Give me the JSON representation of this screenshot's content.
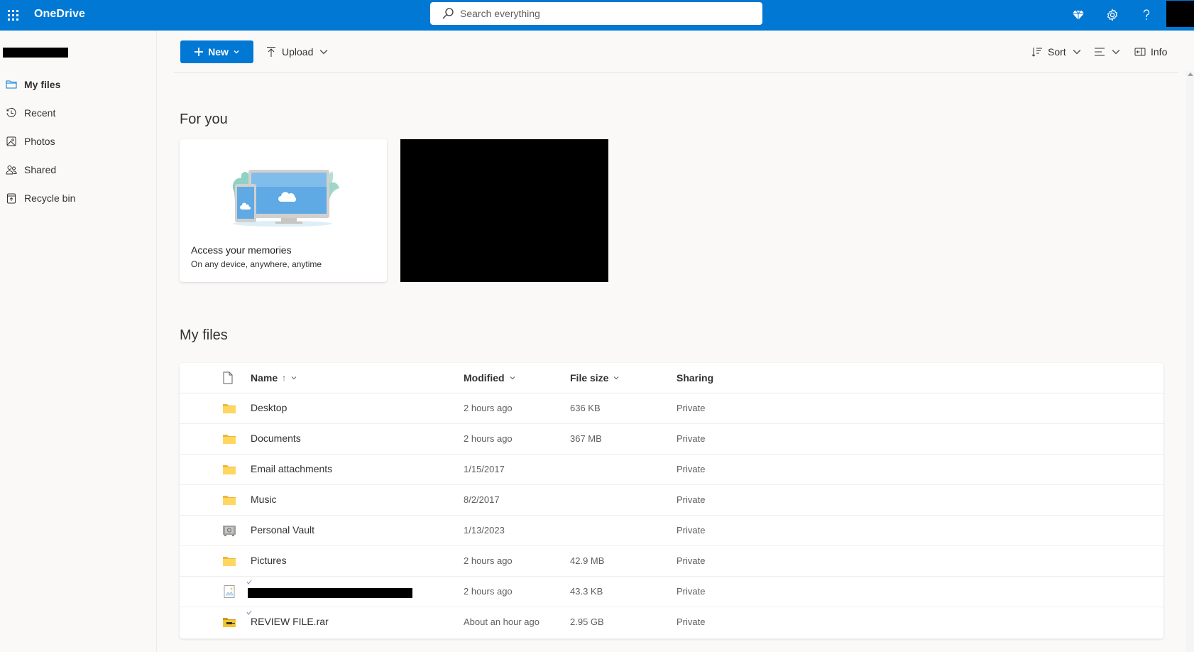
{
  "app": {
    "title": "OneDrive",
    "search_placeholder": "Search everything"
  },
  "topbar": {
    "icons": [
      "app-launcher-icon",
      "premium-diamond-icon",
      "settings-gear-icon",
      "help-icon"
    ]
  },
  "sidebar": {
    "items": [
      {
        "label": "My files",
        "icon": "folder-icon",
        "active": true
      },
      {
        "label": "Recent",
        "icon": "clock-icon",
        "active": false
      },
      {
        "label": "Photos",
        "icon": "photo-icon",
        "active": false
      },
      {
        "label": "Shared",
        "icon": "people-icon",
        "active": false
      },
      {
        "label": "Recycle bin",
        "icon": "recycle-bin-icon",
        "active": false
      }
    ]
  },
  "commandbar": {
    "new_label": "New",
    "upload_label": "Upload",
    "sort_label": "Sort",
    "info_label": "Info"
  },
  "for_you": {
    "title": "For you",
    "card": {
      "title": "Access your memories",
      "subtitle": "On any device, anywhere, anytime"
    }
  },
  "my_files": {
    "title": "My files",
    "columns": {
      "name": "Name",
      "name_sort_indicator": "↑",
      "modified": "Modified",
      "file_size": "File size",
      "sharing": "Sharing"
    },
    "rows": [
      {
        "name": "Desktop",
        "type": "folder",
        "modified": "2 hours ago",
        "size": "636 KB",
        "sharing": "Private"
      },
      {
        "name": "Documents",
        "type": "folder",
        "modified": "2 hours ago",
        "size": "367 MB",
        "sharing": "Private"
      },
      {
        "name": "Email attachments",
        "type": "folder",
        "modified": "1/15/2017",
        "size": "",
        "sharing": "Private"
      },
      {
        "name": "Music",
        "type": "folder",
        "modified": "8/2/2017",
        "size": "",
        "sharing": "Private"
      },
      {
        "name": "Personal Vault",
        "type": "vault",
        "modified": "1/13/2023",
        "size": "",
        "sharing": "Private"
      },
      {
        "name": "Pictures",
        "type": "folder",
        "modified": "2 hours ago",
        "size": "42.9 MB",
        "sharing": "Private"
      },
      {
        "name": "",
        "type": "image",
        "redacted": true,
        "modified": "2 hours ago",
        "size": "43.3 KB",
        "sharing": "Private"
      },
      {
        "name": "REVIEW FILE.rar",
        "type": "archive",
        "modified": "About an hour ago",
        "size": "2.95 GB",
        "sharing": "Private"
      }
    ]
  },
  "colors": {
    "brand_blue": "#0078d4",
    "folder_yellow": "#ffd75e",
    "background": "#faf9f8"
  }
}
